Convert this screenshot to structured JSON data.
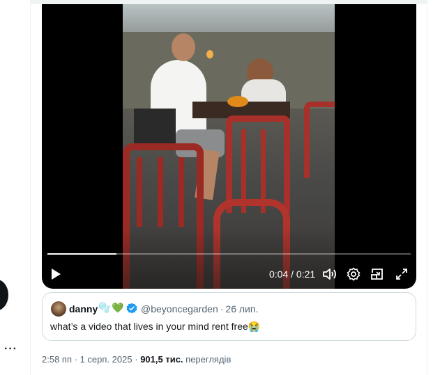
{
  "video": {
    "current_time": "0:04",
    "duration": "0:21",
    "progress_fraction": 0.19,
    "time_separator": " / "
  },
  "quote": {
    "author_name": "danny",
    "author_emojis": [
      "🫧",
      "💚"
    ],
    "handle": "@beyoncegarden",
    "date": "26 лип.",
    "dot": "·",
    "text": "what’s a video that lives in your mind rent free",
    "text_emoji": "😭"
  },
  "meta": {
    "time": "2:58 пп",
    "dot": "·",
    "date": "1 серп. 2025",
    "views_count": "901,5 тис.",
    "views_label": "переглядів"
  },
  "icons": {
    "play": "play-icon",
    "volume": "volume-icon",
    "settings": "gear-icon",
    "pip": "picture-in-picture-icon",
    "fullscreen": "fullscreen-icon",
    "more": "more-icon",
    "verified": "verified-badge-icon"
  },
  "colors": {
    "verified_blue": "#1d9bf0",
    "text_secondary": "#536471",
    "border": "#cfd9de"
  }
}
